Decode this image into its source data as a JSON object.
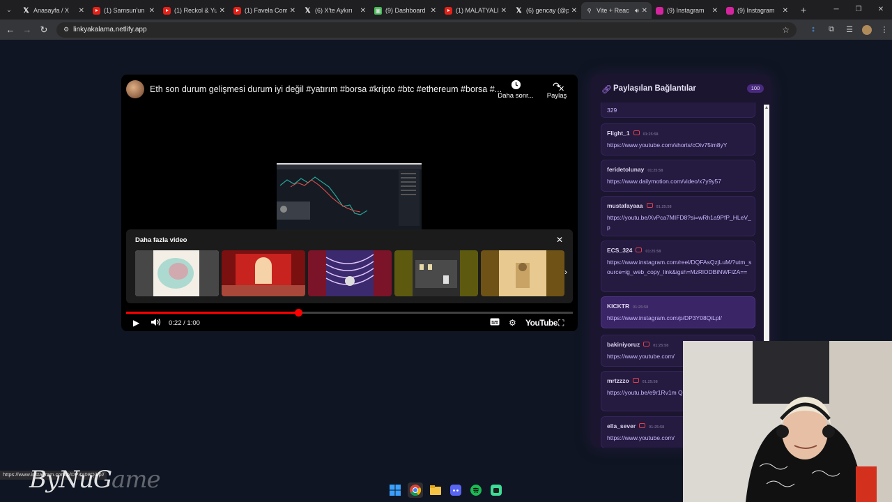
{
  "browser": {
    "tabs": [
      {
        "icon": "x-icon",
        "label": "Anasayfa / X"
      },
      {
        "icon": "youtube-icon",
        "label": "(1) Samsun'un"
      },
      {
        "icon": "youtube-icon",
        "label": "(1) Reckol & Yu"
      },
      {
        "icon": "youtube-icon",
        "label": "(1) Favela Com"
      },
      {
        "icon": "x-icon",
        "label": "(6) X'te Aykırı"
      },
      {
        "icon": "dashboard-icon",
        "label": "(9) Dashboard"
      },
      {
        "icon": "youtube-icon",
        "label": "(1) MALATYALI"
      },
      {
        "icon": "x-icon",
        "label": "(6) gencay (@p"
      },
      {
        "icon": "vite-icon",
        "label": "Vite + Reac"
      },
      {
        "icon": "instagram-icon",
        "label": "(9) Instagram"
      },
      {
        "icon": "instagram-icon",
        "label": "(9) Instagram"
      }
    ],
    "active_tab_index": 8,
    "address": "linkyakalama.netlify.app"
  },
  "player": {
    "title": "Eth son durum gelişmesi durum iyi değil #yatırım #borsa #kripto #btc #ethereum #borsa #...",
    "watch_later_label": "Daha sonr...",
    "share_label": "Paylaş",
    "more_videos_label": "Daha fazla video",
    "time_label": "0:22 / 1:00",
    "progress_fraction": 0.3846,
    "youtube_label": "YouTube"
  },
  "sidebar": {
    "title": "Paylaşılan Bağlantılar",
    "count": "100",
    "partial_top_link": "329",
    "items": [
      {
        "user": "Flight_1",
        "time": "01:25:58",
        "link": "https://www.youtube.com/shorts/cOiv75im8yY"
      },
      {
        "user": "feridetolunay",
        "time": "01:25:58",
        "link": "https://www.dailymotion.com/video/x7y9y57"
      },
      {
        "user": "mustafayaaa",
        "time": "01:25:58",
        "link": "https://youtu.be/XvPca7MIFD8?si=wRh1a9PfP_HLeV_p"
      },
      {
        "user": "ECS_324",
        "time": "01:25:58",
        "link": "https://www.instagram.com/reel/DQFAsQzjLuM/?utm_source=ig_web_copy_link&igsh=MzRlODBiNWFlZA=="
      },
      {
        "user": "KICKTR",
        "time": "01:25:58",
        "link": "https://www.instagram.com/p/DP3Y08QiLpl/"
      },
      {
        "user": "bakiniyoruz",
        "time": "01:25:58",
        "link": "https://www.youtube.com/"
      },
      {
        "user": "mrtzzzo",
        "time": "01:25:58",
        "link": "https://youtu.be/e9r1Rv1m\nQs6Sq"
      },
      {
        "user": "ella_sever",
        "time": "01:25:58",
        "link": "https://www.youtube.com/"
      }
    ]
  },
  "status_url": "https://www.instagram.com/p/DP3Y08QiLpl/",
  "watermark": {
    "part1": "ByNuG",
    "part2": "ame"
  },
  "colors": {
    "accent": "#b784ff",
    "youtube_red": "#ff0000",
    "sidebar_bg": "#1b1530"
  }
}
